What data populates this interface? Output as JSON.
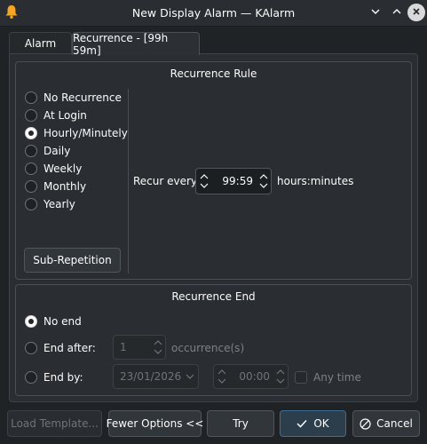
{
  "window": {
    "title": "New Display Alarm — KAlarm",
    "app_icon": "bell-icon",
    "controls": [
      "chevron-down-icon",
      "chevron-up-icon",
      "close-icon"
    ]
  },
  "tabs": [
    {
      "label": "Alarm",
      "active": false
    },
    {
      "label": "Recurrence - [99h 59m]",
      "active": true
    }
  ],
  "recurrence_rule": {
    "title": "Recurrence Rule",
    "options": [
      {
        "label": "No Recurrence",
        "checked": false
      },
      {
        "label": "At Login",
        "checked": false
      },
      {
        "label": "Hourly/Minutely",
        "checked": true
      },
      {
        "label": "Daily",
        "checked": false
      },
      {
        "label": "Weekly",
        "checked": false
      },
      {
        "label": "Monthly",
        "checked": false
      },
      {
        "label": "Yearly",
        "checked": false
      }
    ],
    "sub_repetition_label": "Sub-Repetition",
    "recur_every_label": "Recur every",
    "recur_every_value": "99:59",
    "recur_every_unit": "hours:minutes"
  },
  "recurrence_end": {
    "title": "Recurrence End",
    "no_end_label": "No end",
    "no_end_checked": true,
    "end_after_label": "End after:",
    "end_after_value": "1",
    "end_after_unit": "occurrence(s)",
    "end_by_label": "End by:",
    "end_by_date": "23/01/2026",
    "end_by_time": "00:00",
    "any_time_label": "Any time"
  },
  "footer": {
    "load_template_label": "Load Template...",
    "fewer_options_label": "Fewer Options <<",
    "try_label": "Try",
    "ok_label": "OK",
    "cancel_label": "Cancel"
  },
  "colors": {
    "window_bg": "#202326",
    "panel_bg": "#2a2e32",
    "text": "#fcfcfc",
    "disabled_text": "#6f7479",
    "accent_bell": "#f5a623"
  }
}
